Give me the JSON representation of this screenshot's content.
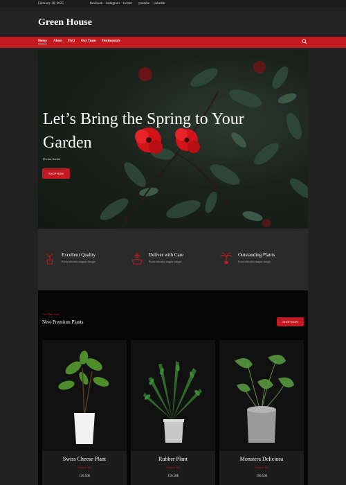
{
  "topbar": {
    "date": "February 18, 2025",
    "social": [
      "facebook",
      "instagram",
      "twitter",
      "youtube",
      "linkedin"
    ]
  },
  "site": {
    "title": "Green House"
  },
  "nav": {
    "items": [
      "Home",
      "About",
      "FAQ",
      "Our Team",
      "Testimonials"
    ],
    "active": "Home",
    "search_icon": "search-icon"
  },
  "hero": {
    "title": "Let’s Bring the Spring to Your Garden",
    "subtitle": "Floriata Garden",
    "button": "SHOP NOW"
  },
  "features": [
    {
      "title": "Excellent Quality",
      "text": "Proin ridiculus magnas integer",
      "icon": "potted-plant-icon"
    },
    {
      "title": "Deliver with Care",
      "text": "Proin ridiculus magna integer",
      "icon": "flower-icon"
    },
    {
      "title": "Outstanding Plants",
      "text": "Proin ridiculus magna integer",
      "icon": "palm-plant-icon"
    }
  ],
  "products": {
    "kicker": "Our Plant Store",
    "title": "New Premium Plants",
    "button": "SHOP NOW",
    "items": [
      {
        "name": "Swiss Cheese Plant",
        "category": "Ceramic Pot",
        "price": "120.50$"
      },
      {
        "name": "Rubber Plant",
        "category": "Ceramic Pot",
        "price": "150.50$"
      },
      {
        "name": "Monstera Deliciosa",
        "category": "Ceramic Pot",
        "price": "190.50$"
      }
    ]
  },
  "colors": {
    "accent": "#c21a20",
    "background": "#222222",
    "card": "#1c1c1c"
  }
}
